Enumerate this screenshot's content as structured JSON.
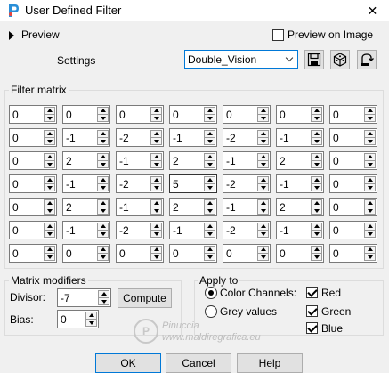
{
  "window": {
    "title": "User Defined Filter",
    "close_glyph": "✕"
  },
  "preview": {
    "label": "Preview",
    "preview_on_image_label": "Preview on Image",
    "preview_on_image_checked": false
  },
  "settings": {
    "label": "Settings",
    "preset_value": "Double_Vision",
    "icons": [
      "save-icon",
      "random-icon",
      "reset-icon"
    ]
  },
  "filter_matrix": {
    "legend": "Filter matrix",
    "rows": [
      [
        "0",
        "0",
        "0",
        "0",
        "0",
        "0",
        "0"
      ],
      [
        "0",
        "-1",
        "-2",
        "-1",
        "-2",
        "-1",
        "0"
      ],
      [
        "0",
        "2",
        "-1",
        "2",
        "-1",
        "2",
        "0"
      ],
      [
        "0",
        "-1",
        "-2",
        "5",
        "-2",
        "-1",
        "0"
      ],
      [
        "0",
        "2",
        "-1",
        "2",
        "-1",
        "2",
        "0"
      ],
      [
        "0",
        "-1",
        "-2",
        "-1",
        "-2",
        "-1",
        "0"
      ],
      [
        "0",
        "0",
        "0",
        "0",
        "0",
        "0",
        "0"
      ]
    ]
  },
  "modifiers": {
    "legend": "Matrix modifiers",
    "divisor_label": "Divisor:",
    "divisor_value": "-7",
    "bias_label": "Bias:",
    "bias_value": "0",
    "compute_label": "Compute"
  },
  "apply_to": {
    "legend": "Apply to",
    "color_channels_label": "Color Channels:",
    "grey_values_label": "Grey values",
    "selected": "color_channels",
    "channels": [
      {
        "label": "Red",
        "checked": true
      },
      {
        "label": "Green",
        "checked": true
      },
      {
        "label": "Blue",
        "checked": true
      }
    ]
  },
  "buttons": {
    "ok": "OK",
    "cancel": "Cancel",
    "help": "Help"
  },
  "watermark": {
    "mark": "P",
    "line1": "Pinuccia",
    "line2": "www.maldiregrafica.eu"
  },
  "colors": {
    "accent": "#0078d7",
    "background": "#f0f0f0"
  }
}
